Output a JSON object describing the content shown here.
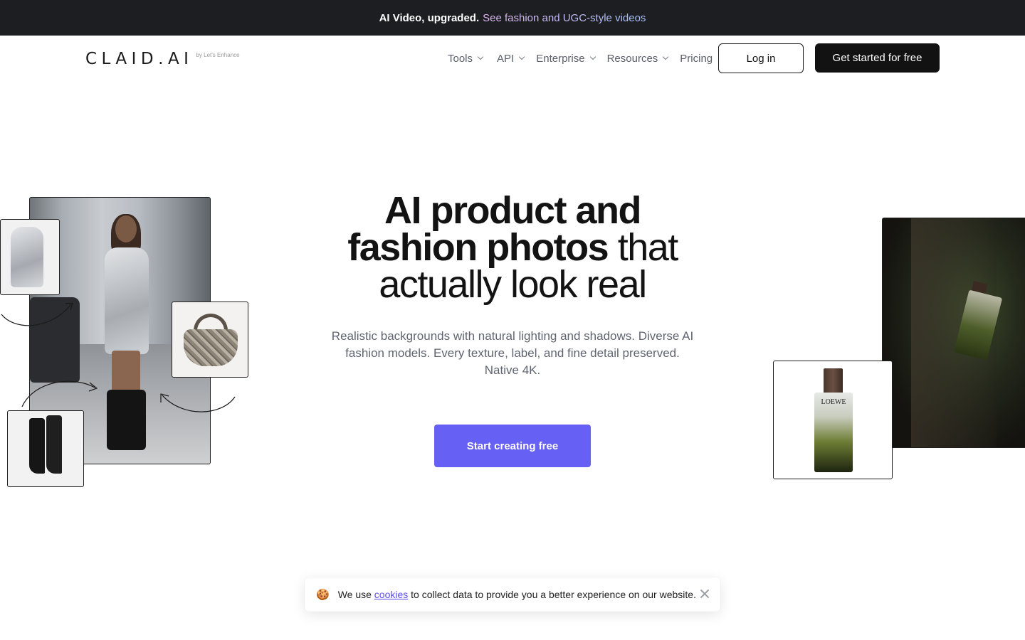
{
  "announcement": {
    "strong": "AI Video, upgraded.",
    "link": "See fashion and UGC-style videos"
  },
  "header": {
    "logo": "CLAID.AI",
    "logo_sub": "by Let's Enhance",
    "nav": [
      {
        "label": "Tools",
        "dropdown": true
      },
      {
        "label": "API",
        "dropdown": true
      },
      {
        "label": "Enterprise",
        "dropdown": true
      },
      {
        "label": "Resources",
        "dropdown": true
      },
      {
        "label": "Pricing",
        "dropdown": false
      }
    ],
    "login_label": "Log in",
    "get_started_label": "Get started for free"
  },
  "hero": {
    "title_line1": "AI product and",
    "title_line2_bold": "fashion photos",
    "title_line2_regular": " that",
    "title_line3": "actually look real",
    "subtitle": "Realistic backgrounds with natural lighting and shadows. Diverse AI fashion models. Every texture, label, and fine detail preserved. Native 4K.",
    "cta_label": "Start creating free"
  },
  "images": {
    "perfume_label": "LOEWE"
  },
  "cookie": {
    "emoji": "🍪",
    "before": "We use ",
    "link": "cookies",
    "after": " to collect data to provide you a better experience on our website."
  },
  "colors": {
    "announcement_bg": "#1d1e21",
    "cta": "#6660f4",
    "primary_button": "#121212",
    "link": "#5b4df0"
  }
}
